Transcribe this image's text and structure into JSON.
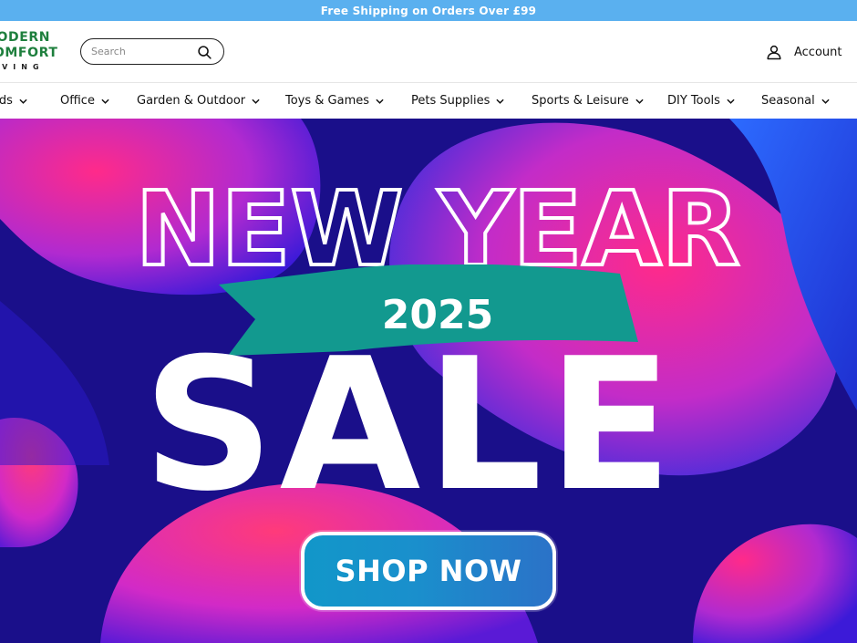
{
  "announcement": {
    "text": "Free Shipping on Orders Over £99"
  },
  "brand": {
    "line1": "MODERN",
    "line2": "COMFORT",
    "line3": "LIVING",
    "color": "#1e7f3d"
  },
  "search": {
    "placeholder": "Search",
    "value": ""
  },
  "account": {
    "label": "Account"
  },
  "nav": {
    "items": [
      {
        "label": "Foods"
      },
      {
        "label": "Office"
      },
      {
        "label": "Garden & Outdoor"
      },
      {
        "label": "Toys & Games"
      },
      {
        "label": "Pets Supplies"
      },
      {
        "label": "Sports & Leisure"
      },
      {
        "label": "DIY Tools"
      },
      {
        "label": "Seasonal"
      }
    ]
  },
  "hero": {
    "headline": "NEW YEAR",
    "year": "2025",
    "sale": "SALE",
    "cta": "SHOP NOW",
    "colors": {
      "background": "#1a0f8a",
      "ribbon": "#12998f",
      "accent_pink": "#ff2a8a"
    }
  },
  "colors": {
    "announcement_bar": "#5ab0ef"
  }
}
